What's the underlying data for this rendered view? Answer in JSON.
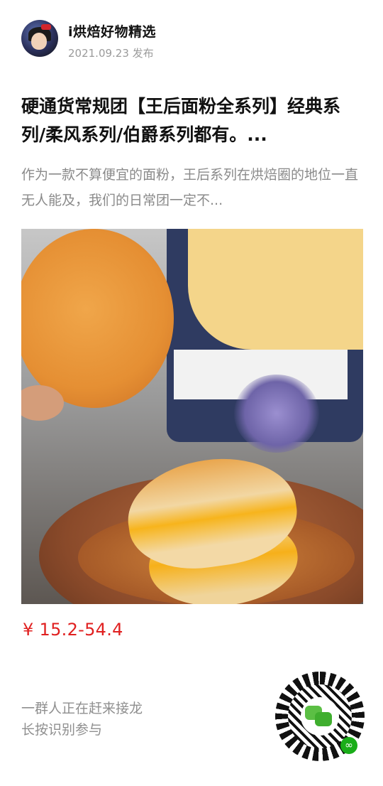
{
  "author": {
    "name": "i烘焙好物精选",
    "date": "2021.09.23 发布"
  },
  "article": {
    "title": "硬通货常规团【王后面粉全系列】经典系列/柔风系列/伯爵系列都有。...",
    "description": "作为一款不算便宜的面粉，王后系列在烘焙圈的地位一直无人能及，我们的日常团一定不..."
  },
  "price": "¥ 15.2-54.4",
  "footer": {
    "line1": "一群人正在赶来接龙",
    "line2": "长按识别参与"
  },
  "icons": {
    "avatar": "profile-avatar",
    "qr": "mini-program-qr-code",
    "wechat": "wechat-logo-icon",
    "mini": "mini-program-icon"
  },
  "colors": {
    "price": "#e02020",
    "wechat_green": "#1aad19"
  }
}
